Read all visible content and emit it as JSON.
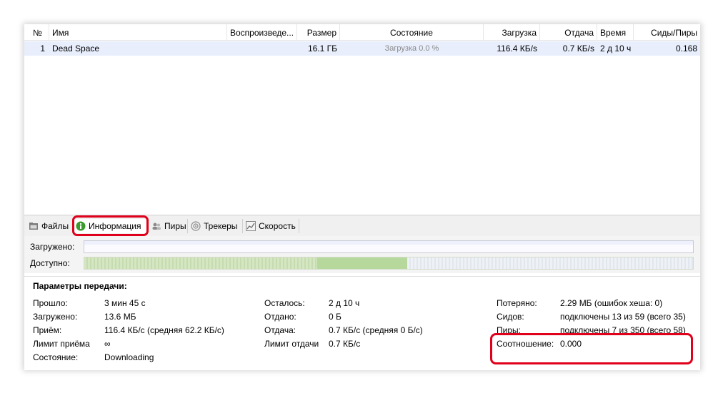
{
  "table": {
    "headers": {
      "num": "№",
      "name": "Имя",
      "play": "Воспроизведе...",
      "size": "Размер",
      "state": "Состояние",
      "down": "Загрузка",
      "up": "Отдача",
      "time": "Время",
      "ratio": "Сиды/Пиры"
    },
    "rows": [
      {
        "num": "1",
        "name": "Dead Space",
        "play": "",
        "size": "16.1 ГБ",
        "state": "Загрузка 0.0 %",
        "down": "116.4 КБ/s",
        "up": "0.7 КБ/s",
        "time": "2 д 10 ч",
        "ratio": "0.168"
      }
    ]
  },
  "tabs": [
    {
      "label": "Файлы",
      "icon": "folder-icon"
    },
    {
      "label": "Информация",
      "icon": "info-icon",
      "active": true
    },
    {
      "label": "Пиры",
      "icon": "users-icon"
    },
    {
      "label": "Трекеры",
      "icon": "radar-icon"
    },
    {
      "label": "Скорость",
      "icon": "chart-icon"
    }
  ],
  "bars": {
    "loaded_label": "Загружено:",
    "available_label": "Доступно:"
  },
  "params": {
    "title": "Параметры передачи:",
    "col1": [
      {
        "label": "Прошло:",
        "value": "3 мин 45 с"
      },
      {
        "label": "Загружено:",
        "value": "13.6 МБ"
      },
      {
        "label": "Приём:",
        "value": "116.4 КБ/с (средняя 62.2 КБ/с)"
      },
      {
        "label": "Лимит приёма",
        "value": "∞"
      },
      {
        "label": "Состояние:",
        "value": "Downloading"
      }
    ],
    "col2": [
      {
        "label": "Осталось:",
        "value": "2 д 10 ч"
      },
      {
        "label": "Отдано:",
        "value": "0 Б"
      },
      {
        "label": "Отдача:",
        "value": "0.7 КБ/с (средняя 0 Б/с)"
      },
      {
        "label": "Лимит отдачи",
        "value": "0.7 КБ/с"
      }
    ],
    "col3": [
      {
        "label": "Потеряно:",
        "value": "2.29 МБ (ошибок хеша: 0)"
      },
      {
        "label": "Сидов:",
        "value": "подключены 13 из 59 (всего 35)"
      },
      {
        "label": "Пиры:",
        "value": "подключены 7 из 350 (всего 58)"
      },
      {
        "label": "Соотношение:",
        "value": "0.000"
      }
    ]
  },
  "colors": {
    "selected_row": "#e8eefc",
    "highlight": "#e0001b",
    "available_fill": "#c9deb4"
  }
}
